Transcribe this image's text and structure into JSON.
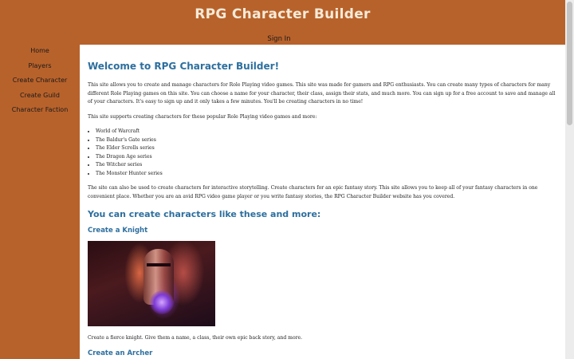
{
  "header": {
    "title": "RPG Character Builder",
    "signin_label": "Sign In"
  },
  "sidebar": {
    "items": [
      {
        "label": "Home"
      },
      {
        "label": "Players"
      },
      {
        "label": "Create Character"
      },
      {
        "label": "Create Guild"
      },
      {
        "label": "Character Faction"
      }
    ]
  },
  "main": {
    "heading": "Welcome to RPG Character Builder!",
    "intro": "This site allows you to create and manage characters for Role Playing video games. This site was made for gamers and RPG enthusiasts. You can create many types of characters for many different Role Playing games on this site. You can choose a name for your character, their class, assign their stats, and much more. You can sign up for a free account to save and manage all of your characters. It's easy to sign up and it only takes a few minutes. You'll be creating characters in no time!",
    "supports": "This site supports creating characters for these popular Role Playing video games and more:",
    "games": [
      "World of Warcraft",
      "The Baldur's Gate series",
      "The Elder Scrolls series",
      "The Dragon Age series",
      "The Witcher series",
      "The Monster Hunter series"
    ],
    "storytelling": "The site can also be used to create characters for interactive storytelling. Create characters for an epic fantasy story. This site allows you to keep all of your fantasy characters in one convenient place. Whether you are an avid RPG video game player or you write fantasy stories, the RPG Character Builder website has you covered.",
    "section_heading": "You can create characters like these and more:",
    "knight_heading": "Create a Knight",
    "knight_caption": "Create a fierce knight. Give them a name, a class, their own epic back story, and more.",
    "archer_heading": "Create an Archer"
  },
  "colors": {
    "background": "#b8622b",
    "heading": "#2d6f9e",
    "title": "#f6ead8"
  }
}
